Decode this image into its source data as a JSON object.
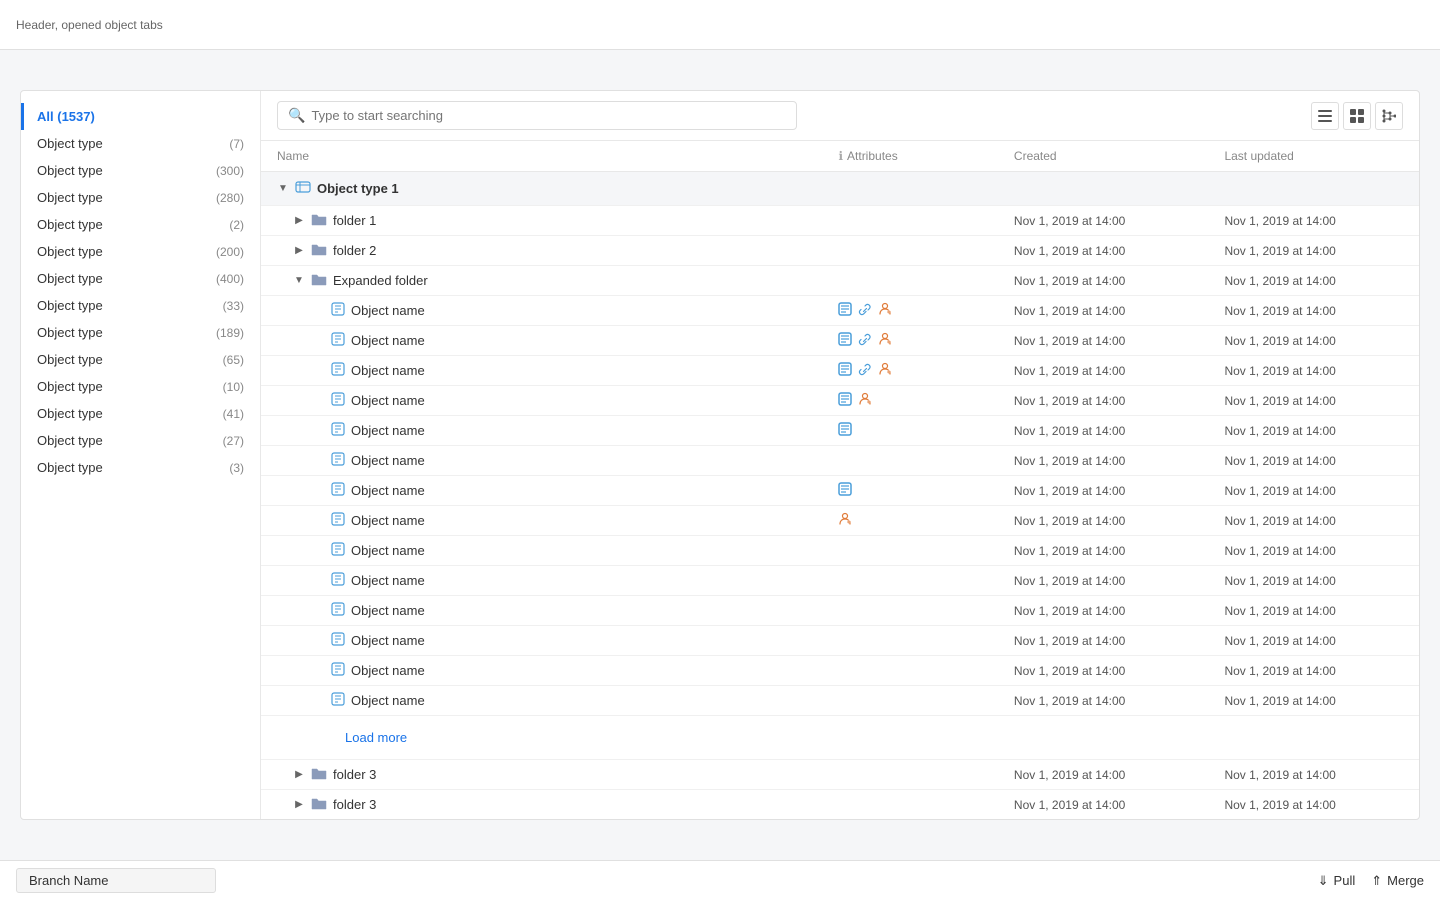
{
  "header": {
    "title": "Header, opened object tabs"
  },
  "sidebar": {
    "all_label": "All",
    "all_count": "(1537)",
    "items": [
      {
        "label": "Object type",
        "count": "(7)"
      },
      {
        "label": "Object type",
        "count": "(300)"
      },
      {
        "label": "Object type",
        "count": "(280)"
      },
      {
        "label": "Object type",
        "count": "(2)"
      },
      {
        "label": "Object type",
        "count": "(200)"
      },
      {
        "label": "Object type",
        "count": "(400)"
      },
      {
        "label": "Object type",
        "count": "(33)"
      },
      {
        "label": "Object type",
        "count": "(189)"
      },
      {
        "label": "Object type",
        "count": "(65)"
      },
      {
        "label": "Object type",
        "count": "(10)"
      },
      {
        "label": "Object type",
        "count": "(41)"
      },
      {
        "label": "Object type",
        "count": "(27)"
      },
      {
        "label": "Object type",
        "count": "(3)"
      }
    ]
  },
  "toolbar": {
    "search_placeholder": "Type to start searching"
  },
  "table": {
    "columns": [
      "Name",
      "Attributes",
      "Created",
      "Last updated"
    ],
    "group1": {
      "name": "Object type 1",
      "rows": [
        {
          "type": "folder",
          "indent": 1,
          "name": "folder 1",
          "created": "Nov 1, 2019 at 14:00",
          "updated": "Nov 1, 2019 at 14:00",
          "expanded": false,
          "attrs": []
        },
        {
          "type": "folder",
          "indent": 1,
          "name": "folder 2",
          "created": "Nov 1, 2019 at 14:00",
          "updated": "Nov 1, 2019 at 14:00",
          "expanded": false,
          "attrs": []
        },
        {
          "type": "folder",
          "indent": 1,
          "name": "Expanded folder",
          "created": "Nov 1, 2019 at 14:00",
          "updated": "Nov 1, 2019 at 14:00",
          "expanded": true,
          "attrs": []
        },
        {
          "type": "object",
          "indent": 2,
          "name": "Object name",
          "created": "Nov 1, 2019 at 14:00",
          "updated": "Nov 1, 2019 at 14:00",
          "attrs": [
            "blue-doc",
            "green-link",
            "orange-user"
          ]
        },
        {
          "type": "object",
          "indent": 2,
          "name": "Object name",
          "created": "Nov 1, 2019 at 14:00",
          "updated": "Nov 1, 2019 at 14:00",
          "attrs": [
            "blue-doc",
            "green-link",
            "orange-user"
          ]
        },
        {
          "type": "object",
          "indent": 2,
          "name": "Object name",
          "created": "Nov 1, 2019 at 14:00",
          "updated": "Nov 1, 2019 at 14:00",
          "attrs": [
            "blue-doc",
            "green-link",
            "orange-user"
          ]
        },
        {
          "type": "object",
          "indent": 2,
          "name": "Object name",
          "created": "Nov 1, 2019 at 14:00",
          "updated": "Nov 1, 2019 at 14:00",
          "attrs": [
            "blue-doc",
            "orange-user"
          ]
        },
        {
          "type": "object",
          "indent": 2,
          "name": "Object name",
          "created": "Nov 1, 2019 at 14:00",
          "updated": "Nov 1, 2019 at 14:00",
          "attrs": [
            "blue-doc"
          ]
        },
        {
          "type": "object",
          "indent": 2,
          "name": "Object name",
          "created": "Nov 1, 2019 at 14:00",
          "updated": "Nov 1, 2019 at 14:00",
          "attrs": []
        },
        {
          "type": "object",
          "indent": 2,
          "name": "Object name",
          "created": "Nov 1, 2019 at 14:00",
          "updated": "Nov 1, 2019 at 14:00",
          "attrs": [
            "blue-doc"
          ]
        },
        {
          "type": "object",
          "indent": 2,
          "name": "Object name",
          "created": "Nov 1, 2019 at 14:00",
          "updated": "Nov 1, 2019 at 14:00",
          "attrs": [
            "orange-user"
          ]
        },
        {
          "type": "object",
          "indent": 2,
          "name": "Object name",
          "created": "Nov 1, 2019 at 14:00",
          "updated": "Nov 1, 2019 at 14:00",
          "attrs": []
        },
        {
          "type": "object",
          "indent": 2,
          "name": "Object name",
          "created": "Nov 1, 2019 at 14:00",
          "updated": "Nov 1, 2019 at 14:00",
          "attrs": []
        },
        {
          "type": "object",
          "indent": 2,
          "name": "Object name",
          "created": "Nov 1, 2019 at 14:00",
          "updated": "Nov 1, 2019 at 14:00",
          "attrs": []
        },
        {
          "type": "object",
          "indent": 2,
          "name": "Object name",
          "created": "Nov 1, 2019 at 14:00",
          "updated": "Nov 1, 2019 at 14:00",
          "attrs": []
        },
        {
          "type": "object",
          "indent": 2,
          "name": "Object name",
          "created": "Nov 1, 2019 at 14:00",
          "updated": "Nov 1, 2019 at 14:00",
          "attrs": []
        },
        {
          "type": "object",
          "indent": 2,
          "name": "Object name",
          "created": "Nov 1, 2019 at 14:00",
          "updated": "Nov 1, 2019 at 14:00",
          "attrs": []
        }
      ],
      "load_more": "Load more",
      "after_rows": [
        {
          "type": "folder",
          "indent": 1,
          "name": "folder 3",
          "created": "Nov 1, 2019 at 14:00",
          "updated": "Nov 1, 2019 at 14:00",
          "expanded": false,
          "attrs": []
        },
        {
          "type": "folder",
          "indent": 1,
          "name": "folder 3",
          "created": "Nov 1, 2019 at 14:00",
          "updated": "Nov 1, 2019 at 14:00",
          "expanded": false,
          "attrs": []
        }
      ]
    }
  },
  "footer": {
    "branch_name": "Branch Name",
    "pull_label": "Pull",
    "merge_label": "Merge"
  }
}
